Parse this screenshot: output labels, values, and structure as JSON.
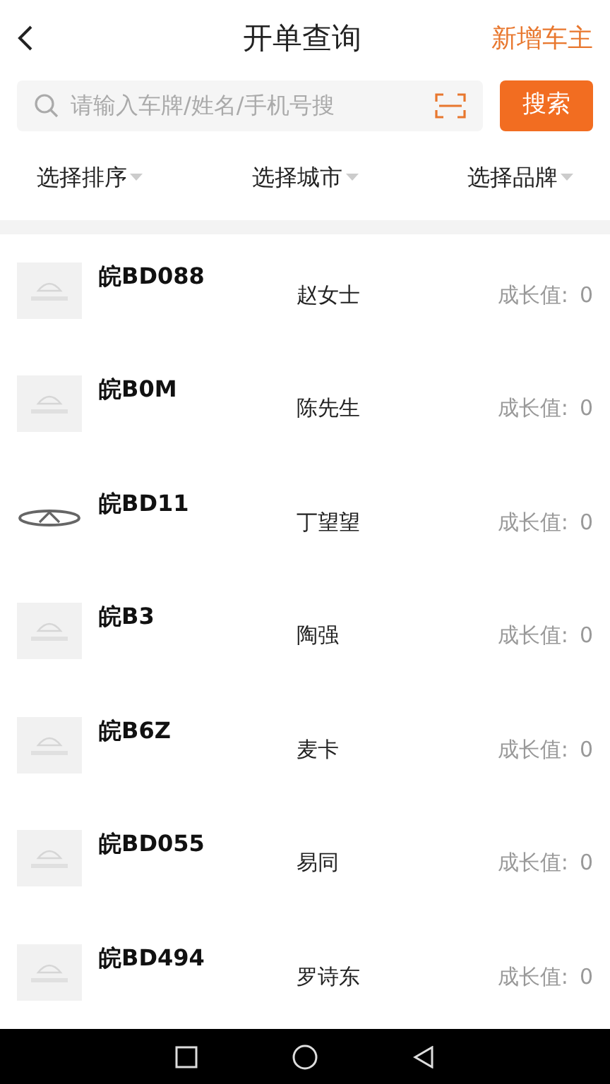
{
  "header": {
    "title": "开单查询",
    "action": "新增车主"
  },
  "search": {
    "placeholder": "请输入车牌/姓名/手机号搜",
    "button": "搜索"
  },
  "filters": [
    "选择排序",
    "选择城市",
    "选择品牌"
  ],
  "rows": [
    {
      "plate": "皖BD088",
      "name": "赵女士",
      "label": "成长值:",
      "value": "0",
      "kind": "placeholder"
    },
    {
      "plate": "皖B0M",
      "name": "陈先生",
      "label": "成长值:",
      "value": "0",
      "kind": "placeholder"
    },
    {
      "plate": "皖BD11",
      "name": "丁望望",
      "label": "成长值:",
      "value": "0",
      "kind": "emblem"
    },
    {
      "plate": "皖B3",
      "name": "陶强",
      "label": "成长值:",
      "value": "0",
      "kind": "placeholder"
    },
    {
      "plate": "皖B6Z",
      "name": "麦卡",
      "label": "成长值:",
      "value": "0",
      "kind": "placeholder"
    },
    {
      "plate": "皖BD055",
      "name": "易同",
      "label": "成长值:",
      "value": "0",
      "kind": "placeholder"
    },
    {
      "plate": "皖BD494",
      "name": "罗诗东",
      "label": "成长值:",
      "value": "0",
      "kind": "placeholder"
    }
  ]
}
